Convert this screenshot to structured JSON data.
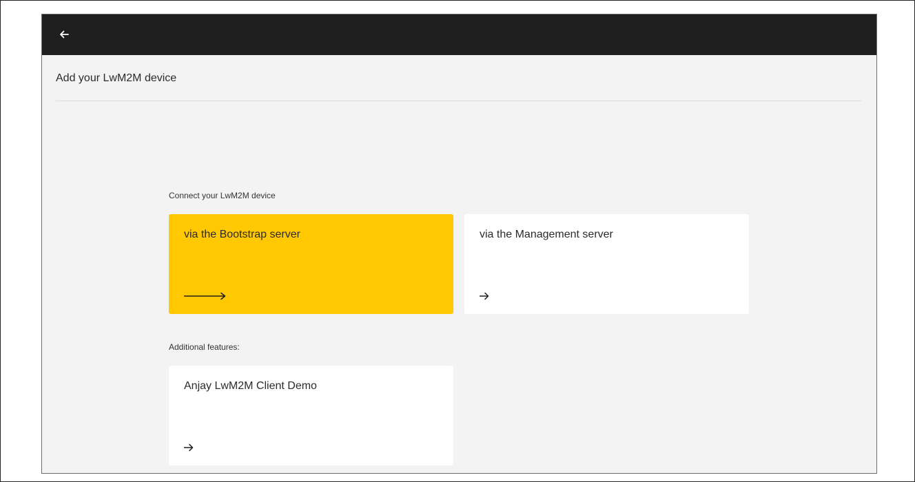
{
  "header": {
    "back_icon": "arrow-left-icon"
  },
  "page": {
    "title": "Add your LwM2M device"
  },
  "connect_section": {
    "label": "Connect your LwM2M device",
    "options": [
      {
        "label": "via the Bootstrap server",
        "icon": "long-arrow-right-icon",
        "highlighted": true,
        "color": "#ffc800"
      },
      {
        "label": "via the Management server",
        "icon": "arrow-right-icon",
        "highlighted": false
      }
    ]
  },
  "additional_section": {
    "label": "Additional features:",
    "options": [
      {
        "label": "Anjay LwM2M Client Demo",
        "icon": "arrow-right-icon"
      }
    ]
  }
}
